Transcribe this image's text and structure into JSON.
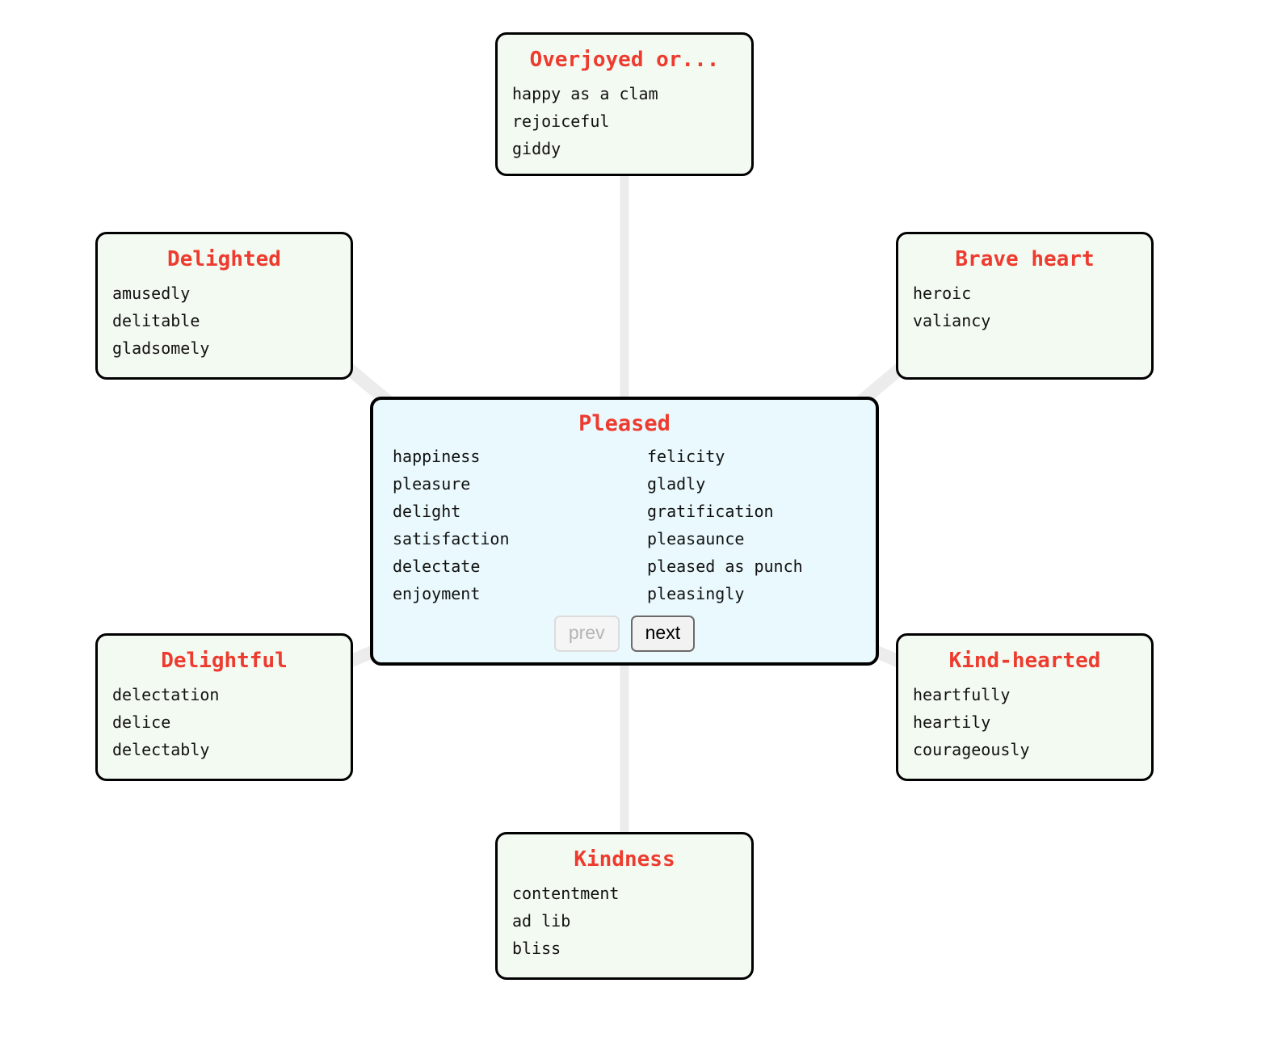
{
  "colors": {
    "title_red": "#ee3b2f",
    "satellite_fill": "#f3faf1",
    "center_fill": "#eaf9fd",
    "node_border": "#000000",
    "edge_gray": "#ececec"
  },
  "center": {
    "title": "Pleased",
    "words_left": [
      "happiness",
      "pleasure",
      "delight",
      "satisfaction",
      "delectate",
      "enjoyment"
    ],
    "words_right": [
      "felicity",
      "gladly",
      "gratification",
      "pleasaunce",
      "pleased as punch",
      "pleasingly"
    ],
    "prev_label": "prev",
    "next_label": "next"
  },
  "nodes": {
    "top": {
      "title": "Overjoyed or...",
      "words": [
        "happy as a clam",
        "rejoiceful",
        "giddy"
      ]
    },
    "topleft": {
      "title": "Delighted",
      "words": [
        "amusedly",
        "delitable",
        "gladsomely"
      ]
    },
    "topright": {
      "title": "Brave heart",
      "words": [
        "heroic",
        "valiancy"
      ]
    },
    "bottomleft": {
      "title": "Delightful",
      "words": [
        "delectation",
        "delice",
        "delectably"
      ]
    },
    "bottomright": {
      "title": "Kind-hearted",
      "words": [
        "heartfully",
        "heartily",
        "courageously"
      ]
    },
    "bottom": {
      "title": "Kindness",
      "words": [
        "contentment",
        "ad lib",
        "bliss"
      ]
    }
  }
}
